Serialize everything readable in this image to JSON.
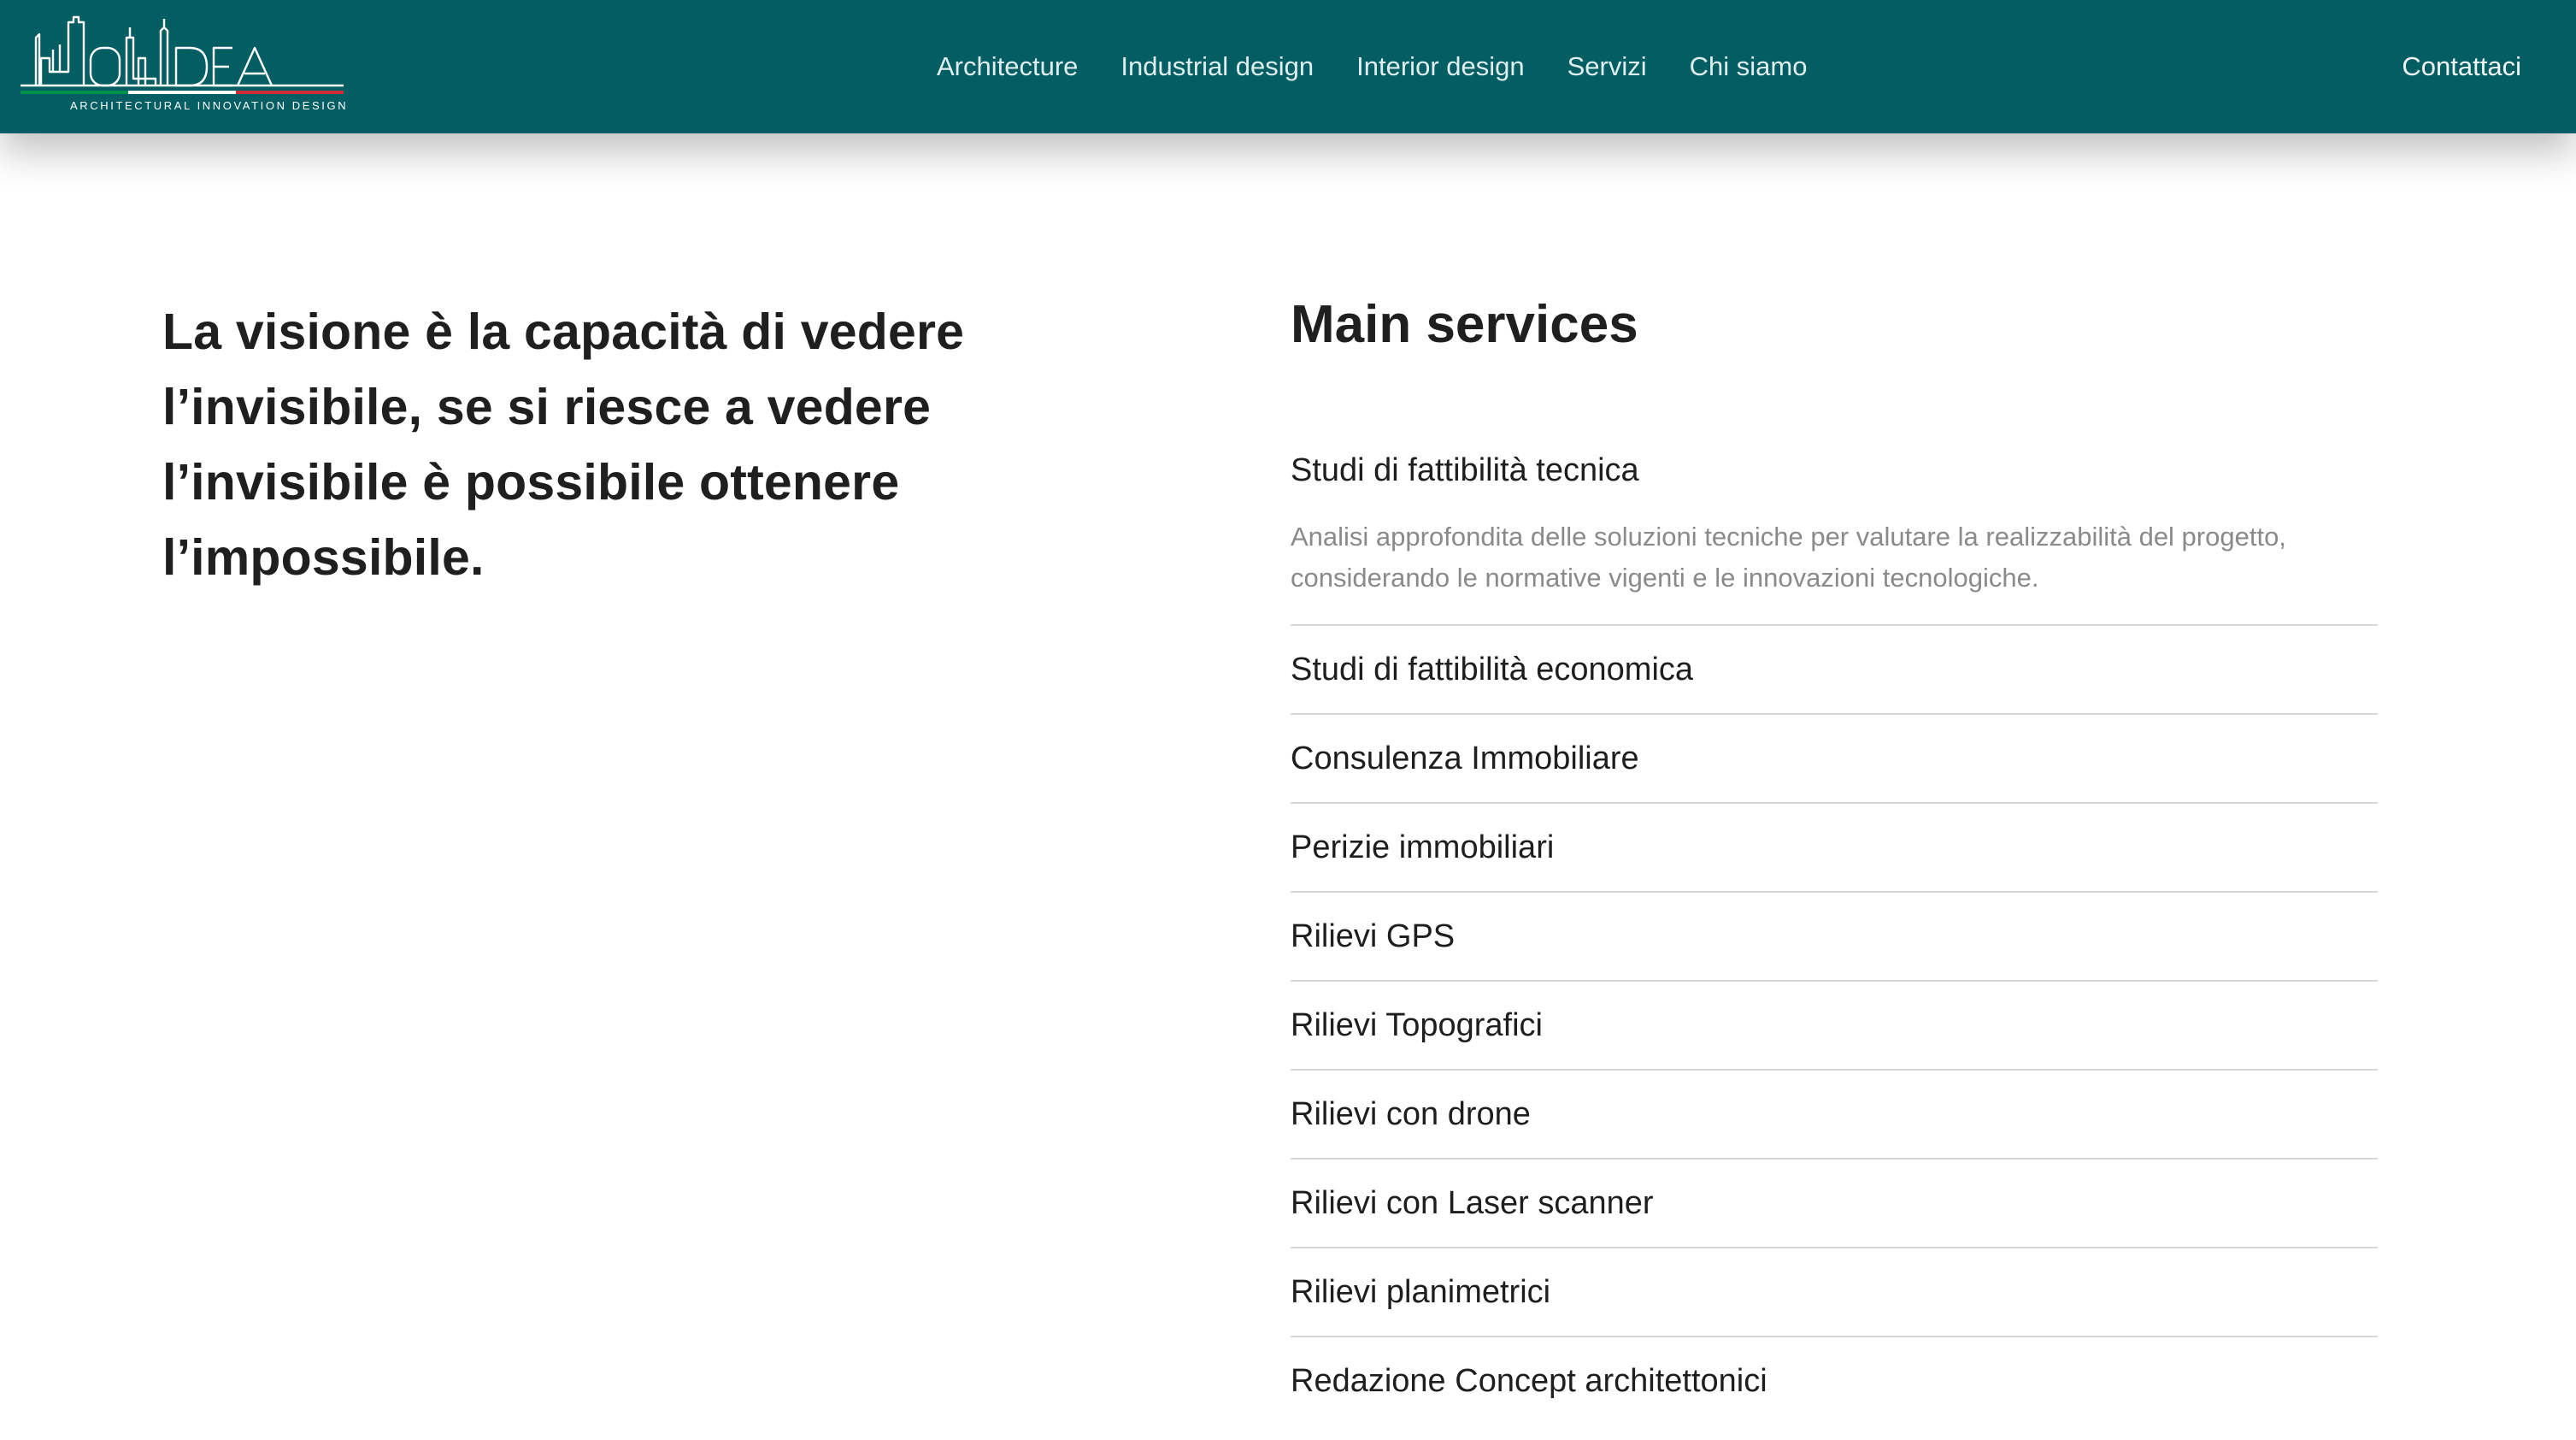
{
  "brand": {
    "logo_text": "HOLIDEA",
    "tagline": "ARCHITECTURAL INNOVATION DESIGN",
    "flag_colors": [
      "#009246",
      "#ffffff",
      "#ce2b37"
    ]
  },
  "nav": {
    "items": [
      {
        "label": "Architecture"
      },
      {
        "label": "Industrial design"
      },
      {
        "label": "Interior design"
      },
      {
        "label": "Servizi"
      },
      {
        "label": "Chi siamo"
      }
    ],
    "contact_label": "Contattaci"
  },
  "quote": {
    "text": "La visione è la capacità di vedere l’invisibile, se si riesce a vedere l’invisibile è possibile ottenere l’impossibile."
  },
  "services": {
    "title": "Main services",
    "items": [
      {
        "title": "Studi di fattibilità tecnica",
        "description": "Analisi approfondita delle soluzioni tecniche per valutare la realizzabilità del progetto, considerando le normative vigenti e le innovazioni tecnologiche.",
        "expanded": true
      },
      {
        "title": "Studi di fattibilità economica",
        "expanded": false
      },
      {
        "title": "Consulenza Immobiliare",
        "expanded": false
      },
      {
        "title": "Perizie immobiliari",
        "expanded": false
      },
      {
        "title": "Rilievi GPS",
        "expanded": false
      },
      {
        "title": "Rilievi Topografici",
        "expanded": false
      },
      {
        "title": "Rilievi con drone",
        "expanded": false
      },
      {
        "title": "Rilievi con Laser scanner",
        "expanded": false
      },
      {
        "title": "Rilievi planimetrici",
        "expanded": false
      },
      {
        "title": "Redazione Concept architettonici",
        "expanded": false
      }
    ]
  },
  "colors": {
    "header_bg": "#035e63",
    "text_dark": "#1f1f1f",
    "text_muted": "#8a8a8a",
    "divider": "#d8d8d8"
  }
}
